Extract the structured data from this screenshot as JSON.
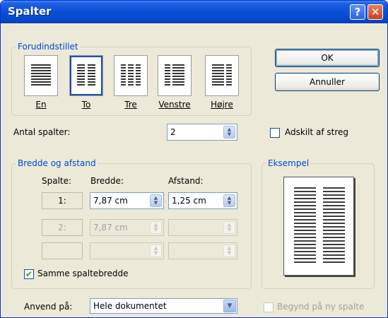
{
  "window": {
    "title": "Spalter"
  },
  "titlebar": {
    "help_glyph": "?",
    "close_glyph": "✕"
  },
  "presets": {
    "legend": "Forudindstillet",
    "items": [
      {
        "label": "En",
        "columns": 1
      },
      {
        "label": "To",
        "columns": 2,
        "selected": true
      },
      {
        "label": "Tre",
        "columns": 3
      },
      {
        "label": "Venstre",
        "columns": 2
      },
      {
        "label": "Højre",
        "columns": 2
      }
    ]
  },
  "buttons": {
    "ok": "OK",
    "cancel": "Annuller"
  },
  "num_columns": {
    "label": "Antal spalter:",
    "value": "2"
  },
  "separator": {
    "label": "Adskilt af streg",
    "checked": false
  },
  "width_spacing": {
    "legend": "Bredde og afstand",
    "headers": {
      "column": "Spalte:",
      "width": "Bredde:",
      "spacing": "Afstand:"
    },
    "rows": [
      {
        "column": "1:",
        "width": "7,87 cm",
        "spacing": "1,25 cm",
        "enabled": true
      },
      {
        "column": "2:",
        "width": "7,87 cm",
        "spacing": "",
        "enabled": false
      },
      {
        "column": "",
        "width": "",
        "spacing": "",
        "enabled": false
      }
    ]
  },
  "equal_width": {
    "label": "Samme spaltebredde",
    "checked": true
  },
  "preview": {
    "legend": "Eksempel"
  },
  "apply_to": {
    "label": "Anvend på:",
    "value": "Hele dokumentet"
  },
  "new_column": {
    "label": "Begynd på ny spalte",
    "checked": false,
    "enabled": false
  },
  "colors": {
    "accent": "#0046D5",
    "title_bar": "#0A4FD8",
    "dialog_bg": "#ECE9D8"
  }
}
